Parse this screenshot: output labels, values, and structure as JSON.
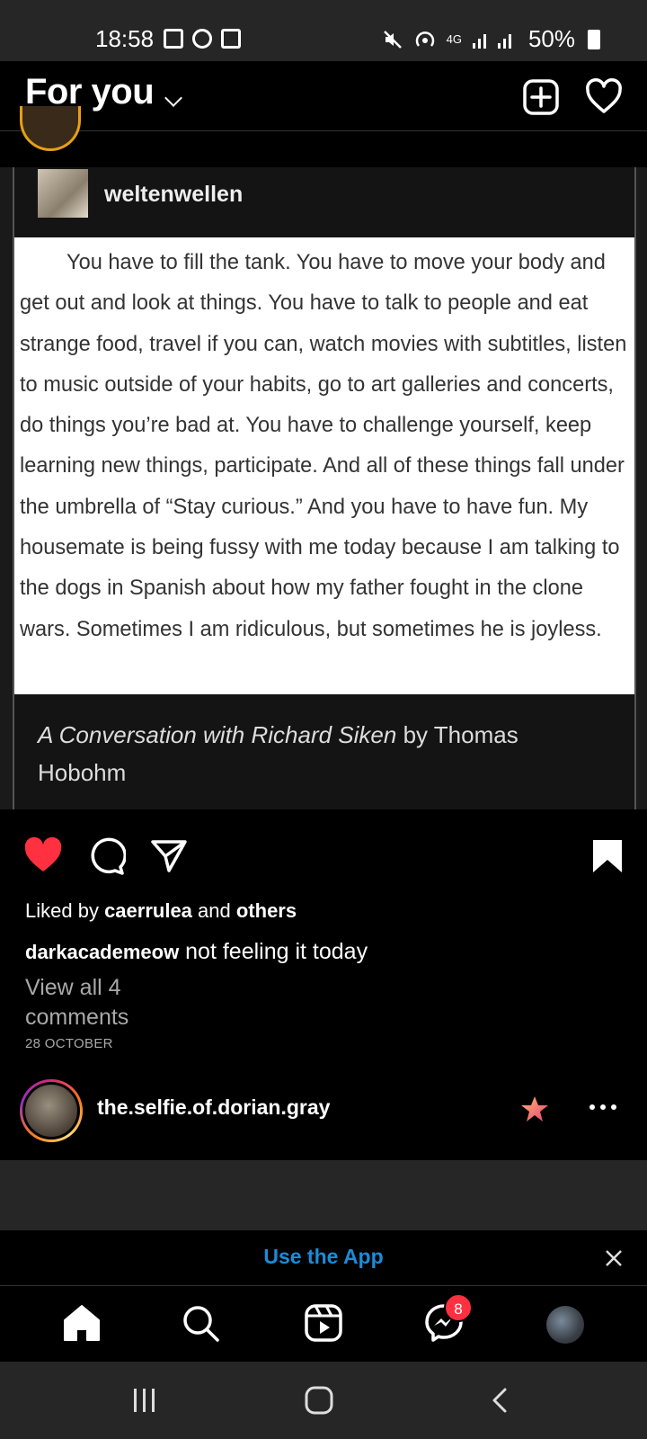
{
  "status_bar": {
    "time": "18:58",
    "network": "4G",
    "battery": "50%"
  },
  "header": {
    "title": "For you",
    "new_post_icon": "plus-square-icon",
    "activity_icon": "heart-icon"
  },
  "post": {
    "image": {
      "tumblr_username": "weltenwellen",
      "quote": "You have to fill the tank. You have to move your body and get out and look at things. You have to talk to people and eat strange food, travel if you can, watch movies with subtitles, listen to music outside of your habits, go to art galleries and concerts, do things you’re bad at. You have to challenge yourself, keep learning new things, participate. And all of these things fall under the umbrella of “Stay curious.” And you have to have fun. My housemate is being fussy with me today because I am talking to the dogs in Spanish about how my father fought in the clone wars. Sometimes I am ridiculous, but sometimes he is joyless.",
      "caption_title": "A Conversation with Richard Siken",
      "caption_by": " by Thomas Hobohm"
    },
    "likes": {
      "prefix": "Liked by ",
      "user": "caerrulea",
      "middle": " and ",
      "others": "others"
    },
    "author": "darkacademeow",
    "caption": " not feeling it today",
    "view_comments": "View all 4 comments",
    "date": "28 OCTOBER",
    "liked": true,
    "saved": true
  },
  "next_post": {
    "username": "the.selfie.of.dorian.gray"
  },
  "banner": {
    "label": "Use the App"
  },
  "bottom_nav": {
    "items": [
      "home-icon",
      "search-icon",
      "reels-icon",
      "messenger-icon",
      "profile-avatar"
    ],
    "messages_badge": "8"
  },
  "colors": {
    "like_red": "#ff3040",
    "link_blue": "#1a8cd8",
    "background": "#000000"
  }
}
